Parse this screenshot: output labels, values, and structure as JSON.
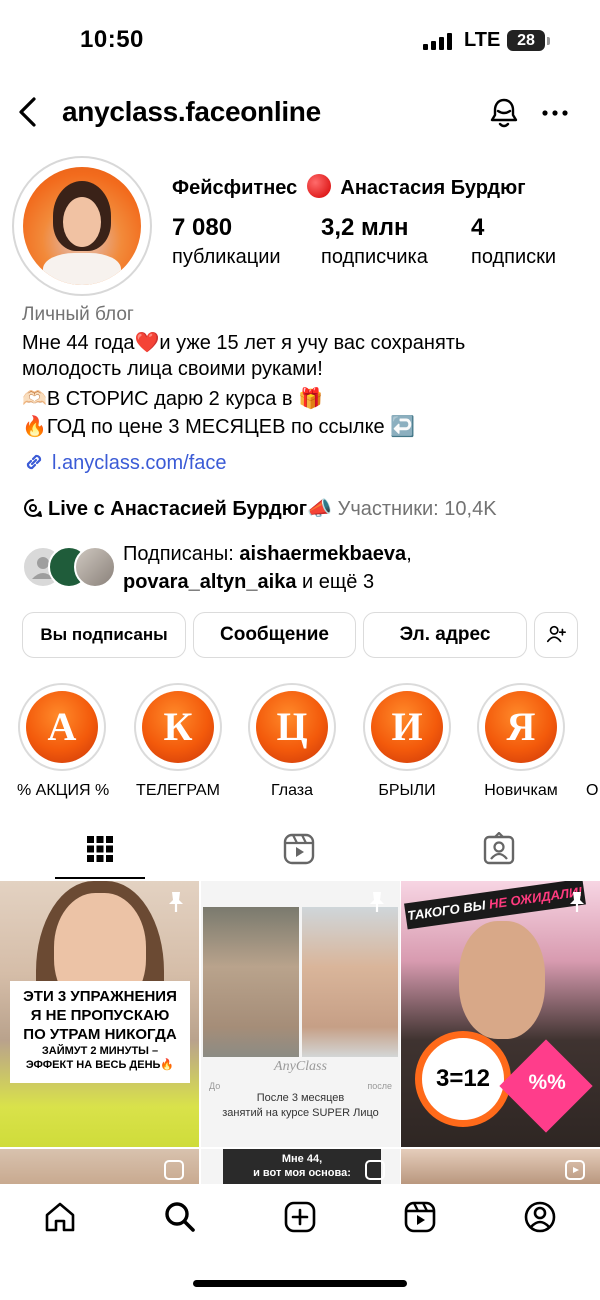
{
  "status_bar": {
    "time": "10:50",
    "network": "LTE",
    "battery": "28"
  },
  "header": {
    "username": "anyclass.faceonline",
    "icons": [
      "back-icon",
      "notification-bell-icon",
      "more-icon"
    ]
  },
  "profile": {
    "name_part1": "Фейсфитнес",
    "name_part2": "Анастасия Бурдюг",
    "stats": [
      {
        "value": "7 080",
        "label": "публикации"
      },
      {
        "value": "3,2 млн",
        "label": "подписчика"
      },
      {
        "value": "4",
        "label": "подписки"
      }
    ]
  },
  "bio": {
    "category": "Личный блог",
    "line1": "Мне 44 года❤️и уже 15 лет я учу вас сохранять",
    "line2": "молодость лица своими руками!",
    "line3": "🫶🏻В СТОРИС дарю 2 курса в 🎁",
    "line4": "🔥ГОД по цене 3 МЕСЯЦЕВ по ссылке ↩️",
    "link": "l.anyclass.com/face"
  },
  "live": {
    "title": "Live с Анастасией Бурдюг📣",
    "participants": "Участники: 10,4K"
  },
  "followed_by": {
    "prefix": "Подписаны: ",
    "user1": "aishaermekbaeva",
    "separator": ",",
    "user2": "povara_altyn_aika",
    "suffix": " и ещё 3"
  },
  "buttons": {
    "following": "Вы подписаны",
    "message": "Сообщение",
    "email": "Эл. адрес",
    "add_person_icon": "add-person-icon"
  },
  "highlights": [
    {
      "letter": "А",
      "label": "% АКЦИЯ %"
    },
    {
      "letter": "К",
      "label": "ТЕЛЕГРАМ"
    },
    {
      "letter": "Ц",
      "label": "Глаза"
    },
    {
      "letter": "И",
      "label": "БРЫЛИ"
    },
    {
      "letter": "Я",
      "label": "Новичкам"
    },
    {
      "letter": "",
      "label": "О"
    }
  ],
  "tabs": [
    "grid-icon",
    "reels-icon",
    "tagged-icon"
  ],
  "posts": {
    "post1": {
      "line1": "ЭТИ 3 УПРАЖНЕНИЯ",
      "line2": "Я НЕ ПРОПУСКАЮ",
      "line3": "ПО УТРАМ НИКОГДА",
      "line4": "ЗАЙМУТ 2 МИНУТЫ –",
      "line5": "ЭФФЕКТ НА ВЕСЬ ДЕНЬ🔥"
    },
    "post2": {
      "brand": "AnyClass",
      "before": "До",
      "after": "после",
      "caption1": "После 3 месяцев",
      "caption2": "занятий на курсе SUPER Лицо"
    },
    "post3": {
      "banner_a": "ТАКОГО ВЫ ",
      "banner_b": "НЕ ОЖИДАЛИ!",
      "equation": "3=12",
      "badge": "%%"
    },
    "post5": {
      "line1": "Мне 44,",
      "line2": "и вот моя основа:"
    }
  },
  "bottom_nav": [
    "home-icon",
    "search-icon",
    "create-icon",
    "reels-icon",
    "profile-icon"
  ],
  "colors": {
    "link_blue": "#3b5bd6",
    "highlight_orange": "#f35a0b",
    "muted": "#737373"
  }
}
